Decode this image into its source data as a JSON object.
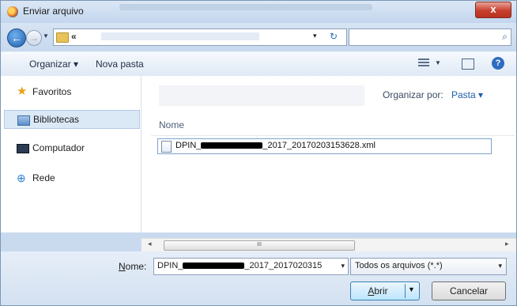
{
  "window": {
    "title": "Enviar arquivo",
    "close_glyph": "x"
  },
  "address": {
    "separator": "«",
    "dropdown": "▾",
    "refresh": "↻"
  },
  "toolbar": {
    "organize_label": "Organizar ▾",
    "new_folder_label": "Nova pasta"
  },
  "sidebar": {
    "items": [
      {
        "label": "Favoritos",
        "icon": "star-icon"
      },
      {
        "label": "Bibliotecas",
        "icon": "library-icon",
        "selected": true
      },
      {
        "label": "Computador",
        "icon": "computer-icon"
      },
      {
        "label": "Rede",
        "icon": "network-icon"
      }
    ]
  },
  "content": {
    "arrange_label": "Organizar por:",
    "arrange_value": "Pasta ▾",
    "column_header": "Nome",
    "file_prefix": "DPIN_",
    "file_suffix": "_2017_20170203153628.xml"
  },
  "scroll": {
    "left": "◂",
    "right": "▸",
    "thumb": "III"
  },
  "bottom": {
    "filename_label_u": "N",
    "filename_label_rest": "ome:",
    "filename_prefix": "DPIN_",
    "filename_suffix": "_2017_2017020315",
    "filetype_value": "Todos os arquivos (*.*)",
    "open_label": "Abrir",
    "cancel_label": "Cancelar"
  }
}
